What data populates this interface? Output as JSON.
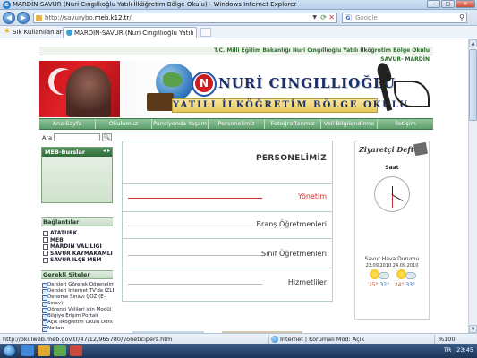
{
  "window": {
    "title": "MARDİN-SAVUR (Nuri Cıngıllıoğlu Yatılı İlköğretim Bölge Okulu) - Windows Internet Explorer",
    "buttons": {
      "minimize": "–",
      "maximize": "□",
      "close": "✕"
    }
  },
  "address_bar": {
    "url_prefix": "http://savurybo.",
    "url_domain": "meb.k12.tr",
    "url_suffix": "/",
    "search_placeholder": "Google"
  },
  "favorites_bar": {
    "label": "Sık Kullanılanlar",
    "tab_title": "MARDİN-SAVUR (Nuri Cıngıllıoğlu Yatılı İlköğreti..."
  },
  "site": {
    "header_line1": "T.C. Milli Eğitim Bakanlığı Nuri Cıngıllıoğlu Yatılı İlköğretim Bölge Okulu",
    "header_line2": "SAVUR- MARDİN",
    "school_name_1": "NURİ CINGILLIOĞLU",
    "school_name_2": "YATILI İLKÖĞRETİM BÖLGE OKULU",
    "logo_letter": "N",
    "nav": [
      "Ana Sayfa",
      "Okulumuz",
      "Pansiyonda Yaşam",
      "Personelimiz",
      "Fotoğraflarımız",
      "Veli Bilgilendirme",
      "İletişim"
    ],
    "search": {
      "label": "Ara",
      "button": "🔍"
    },
    "meb_box": {
      "title": "MEB-Burslar",
      "arrows": "◂ ▸"
    },
    "links_header": "Bağlantılar",
    "links": [
      "ATATÜRK",
      "MEB",
      "MARDİN VALİLİĞİ",
      "SAVUR KAYMAKAMLIĞI",
      "SAVUR İLÇE MEM"
    ],
    "sites_header": "Gerekli Siteler",
    "sites": [
      "Dersleri Görerek Öğrenelim",
      "Dersleri İnternet TV'de İZLE",
      "Deneme Sınavı ÇÖZ (E-",
      "Sınav)",
      "Öğrenci Velileri için Modül",
      "Bilgiye Erişim Portalı",
      "Açık İlköğretim Okulu Ders",
      "Notları"
    ],
    "page_title": "PERSONELİMİZ",
    "menu_items": [
      {
        "label": "Yönetim",
        "active": true
      },
      {
        "label": "Branş Öğretmenleri",
        "active": false
      },
      {
        "label": "Sınıf Öğretmenleri",
        "active": false
      },
      {
        "label": "Hizmetliler",
        "active": false
      }
    ],
    "guestbook_title": "Ziyaretçi Defteri",
    "clock_label": "Saat",
    "weather": {
      "title": "Savur Hava Durumu",
      "dates": "23.09.2010  24.09.2010",
      "temps": [
        {
          "hi": "25°",
          "lo": "32°"
        },
        {
          "hi": "24°",
          "lo": "33°"
        }
      ]
    }
  },
  "status_bar": {
    "url": "http://okulweb.meb.gov.tr/47/12/965780/yoneticipers.htm",
    "zone": "Internet | Korumalı Mod: Açık",
    "zoom": "%100"
  },
  "taskbar": {
    "language": "TR",
    "time": "23:45"
  },
  "colors": {
    "nav_green": "#5d9e6c",
    "active_red": "#cc3333",
    "title_navy": "#1c2f6a",
    "flag_red": "#e32028"
  },
  "icons": [
    "ie-icon",
    "back-icon",
    "forward-icon",
    "page-icon",
    "refresh-icon",
    "stop-icon",
    "google-icon",
    "search-icon",
    "star-icon",
    "globe-icon",
    "book-icon",
    "clock-icon",
    "sun-icon",
    "cloud-icon",
    "start-icon"
  ]
}
